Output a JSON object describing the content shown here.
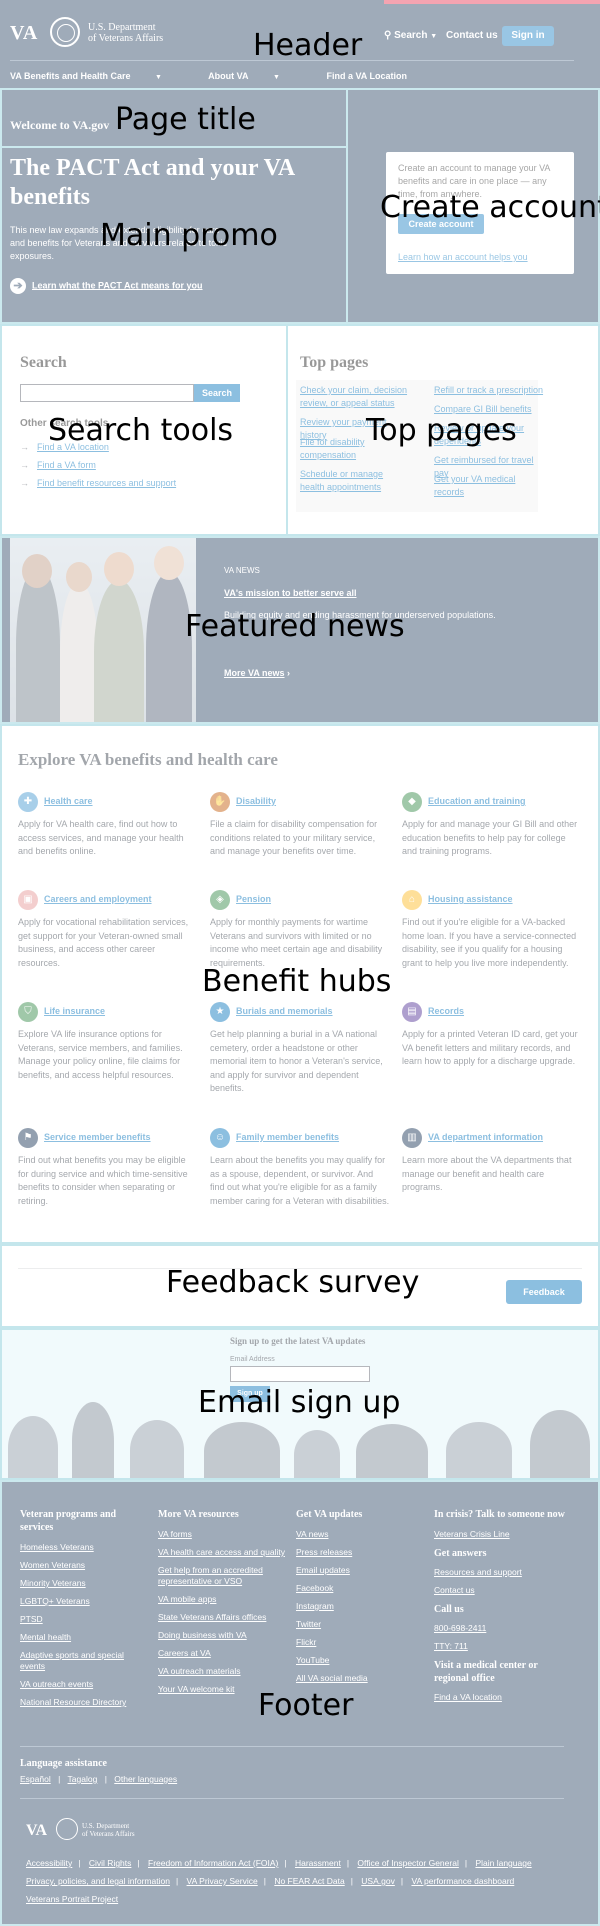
{
  "region_labels": {
    "header": "Header",
    "page_title": "Page title",
    "main_promo": "Main promo",
    "create_account": "Create account",
    "search_tools": "Search tools",
    "top_pages": "Top pages",
    "featured_news": "Featured news",
    "benefit_hubs": "Benefit hubs",
    "feedback_survey": "Feedback survey",
    "email_sign_up": "Email sign up",
    "footer": "Footer"
  },
  "header": {
    "logo_text": "VA",
    "agency_line1": "U.S. Department",
    "agency_line2": "of Veterans Affairs",
    "search": "Search",
    "contact": "Contact us",
    "sign_in": "Sign in",
    "nav": [
      "VA Benefits and Health Care",
      "About VA",
      "Find a VA Location"
    ]
  },
  "hero": {
    "welcome": "Welcome to VA.gov",
    "promo_title": "The PACT Act and your VA benefits",
    "promo_text": "This new law expands and extends eligibility for care and benefits for Veterans and survivors related to toxic exposures.",
    "promo_link": "Learn what the PACT Act means for you",
    "account_text": "Create an account to manage your VA benefits and care in one place — any time, from anywhere.",
    "account_button": "Create account",
    "account_link": "Learn how an account helps you"
  },
  "search_tools": {
    "title": "Search",
    "button": "Search",
    "other_tools_title": "Other search tools",
    "links": [
      "Find a VA location",
      "Find a VA form",
      "Find benefit resources and support"
    ]
  },
  "top_pages": {
    "title": "Top pages",
    "left": [
      "Check your claim, decision review, or appeal status",
      "Review your payment history",
      "File for disability compensation",
      "Schedule or manage health appointments"
    ],
    "right": [
      "Refill or track a prescription",
      "Compare GI Bill benefits",
      "Review or update your dependents",
      "Get reimbursed for travel pay",
      "Get your VA medical records"
    ]
  },
  "news": {
    "eyebrow": "VA NEWS",
    "title": "VA's mission to better serve all",
    "text": "Building equity and ending harassment for underserved populations.",
    "more": "More VA news"
  },
  "hubs": {
    "title": "Explore VA benefits and health care",
    "items": [
      {
        "title": "Health care",
        "icon": "medkit-icon",
        "color": "#3e94cf",
        "desc": "Apply for VA health care, find out how to access services, and manage your health and benefits online."
      },
      {
        "title": "Disability",
        "icon": "hand-icon",
        "color": "#c05600",
        "desc": "File a claim for disability compensation for conditions related to your military service, and manage your benefits over time."
      },
      {
        "title": "Education and training",
        "icon": "graduation-cap-icon",
        "color": "#2e8540",
        "desc": "Apply for and manage your GI Bill and other education benefits to help pay for college and training programs."
      },
      {
        "title": "Careers and employment",
        "icon": "briefcase-icon",
        "color": "#e59393",
        "desc": "Apply for vocational rehabilitation services, get support for your Veteran-owned small business, and access other career resources."
      },
      {
        "title": "Pension",
        "icon": "handshake-icon",
        "color": "#2e8540",
        "desc": "Apply for monthly payments for wartime Veterans and survivors with limited or no income who meet certain age and disability requirements."
      },
      {
        "title": "Housing assistance",
        "icon": "home-icon",
        "color": "#fdb81e",
        "desc": "Find out if you're eligible for a VA-backed home loan. If you have a service-connected disability, see if you qualify for a housing grant to help you live more independently."
      },
      {
        "title": "Life insurance",
        "icon": "shield-icon",
        "color": "#2e8540",
        "desc": "Explore VA life insurance options for Veterans, service members, and families. Manage your policy online, file claims for benefits, and access helpful resources."
      },
      {
        "title": "Burials and memorials",
        "icon": "star-icon",
        "color": "#0071bb",
        "desc": "Get help planning a burial in a VA national cemetery, order a headstone or other memorial item to honor a Veteran's service, and apply for survivor and dependent benefits."
      },
      {
        "title": "Records",
        "icon": "file-icon",
        "color": "#4c2c92",
        "desc": "Apply for a printed Veteran ID card, get your VA benefit letters and military records, and learn how to apply for a discharge upgrade."
      },
      {
        "title": "Service member benefits",
        "icon": "flag-icon",
        "color": "#112e51",
        "desc": "Find out what benefits you may be eligible for during service and which time-sensitive benefits to consider when separating or retiring."
      },
      {
        "title": "Family member benefits",
        "icon": "family-icon",
        "color": "#0071bb",
        "desc": "Learn about the benefits you may qualify for as a spouse, dependent, or survivor. And find out what you're eligible for as a family member caring for a Veteran with disabilities."
      },
      {
        "title": "VA department information",
        "icon": "building-icon",
        "color": "#112e51",
        "desc": "Learn more about the VA departments that manage our benefit and health care programs."
      }
    ]
  },
  "feedback": {
    "button": "Feedback"
  },
  "signup": {
    "title": "Sign up to get the latest VA updates",
    "label": "Email Address",
    "button": "Sign up"
  },
  "footer": {
    "col1": {
      "title": "Veteran programs and services",
      "links": [
        "Homeless Veterans",
        "Women Veterans",
        "Minority Veterans",
        "LGBTQ+ Veterans",
        "PTSD",
        "Mental health",
        "Adaptive sports and special events",
        "VA outreach events",
        "National Resource Directory"
      ]
    },
    "col2": {
      "title": "More VA resources",
      "links": [
        "VA forms",
        "VA health care access and quality",
        "Get help from an accredited representative or VSO",
        "VA mobile apps",
        "State Veterans Affairs offices",
        "Doing business with VA",
        "Careers at VA",
        "VA outreach materials",
        "Your VA welcome kit"
      ]
    },
    "col3": {
      "title": "Get VA updates",
      "links": [
        "VA news",
        "Press releases",
        "Email updates",
        "Facebook",
        "Instagram",
        "Twitter",
        "Flickr",
        "YouTube",
        "All VA social media"
      ]
    },
    "col4": {
      "title": "In crisis? Talk to someone now",
      "crisis_link": "Veterans Crisis Line",
      "answers_title": "Get answers",
      "answers_links": [
        "Resources and support",
        "Contact us"
      ],
      "call_title": "Call us",
      "call_links": [
        "800-698-2411",
        "TTY: 711"
      ],
      "visit_title": "Visit a medical center or regional office",
      "visit_link": "Find a VA location"
    },
    "language_title": "Language assistance",
    "languages": [
      "Español",
      "Tagalog",
      "Other languages"
    ],
    "legal_row1": [
      "Accessibility",
      "Civil Rights",
      "Freedom of Information Act (FOIA)",
      "Harassment",
      "Office of Inspector General",
      "Plain language"
    ],
    "legal_row2": [
      "Privacy, policies, and legal information",
      "VA Privacy Service",
      "No FEAR Act Data",
      "USA.gov",
      "VA performance dashboard"
    ],
    "legal_row3": [
      "Veterans Portrait Project"
    ]
  }
}
